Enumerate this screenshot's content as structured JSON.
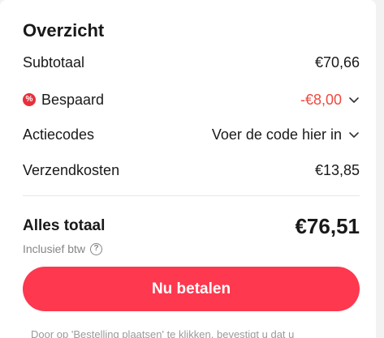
{
  "summary": {
    "title": "Overzicht",
    "rows": {
      "subtotal": {
        "label": "Subtotaal",
        "value": "€70,66"
      },
      "saved": {
        "label": "Bespaard",
        "value": "-€8,00",
        "icon": "discount-percent-icon",
        "value_color": "#f0483e"
      },
      "promo": {
        "label": "Actiecodes",
        "value": "Voer de code hier in"
      },
      "shipping": {
        "label": "Verzendkosten",
        "value": "€13,85"
      }
    },
    "total": {
      "label": "Alles totaal",
      "value": "€76,51",
      "note": "Inclusief btw"
    },
    "pay_button_label": "Nu betalen",
    "accent_color": "#fd384f",
    "terms_text": "Door op 'Bestelling plaatsen' te klikken, bevestigt u dat u"
  }
}
